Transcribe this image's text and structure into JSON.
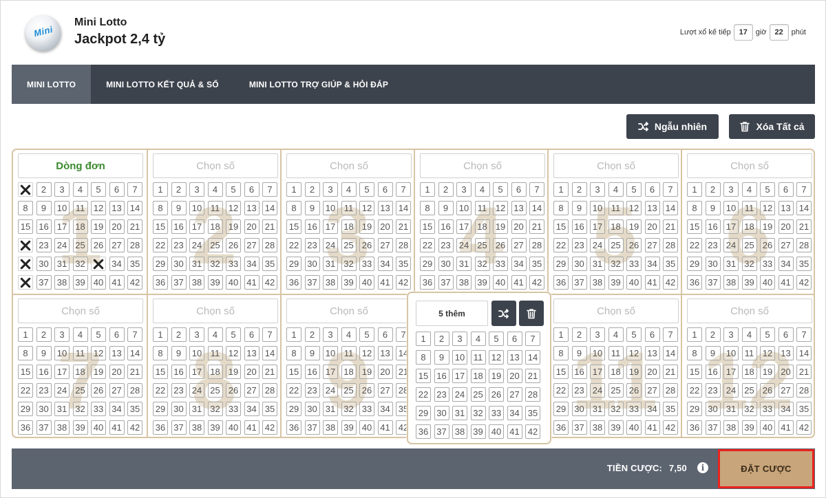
{
  "header": {
    "logo_text": "Mini",
    "game_name": "Mini Lotto",
    "jackpot": "Jackpot 2,4 tỷ",
    "next_draw_label": "Lượt xổ kế tiếp",
    "hours": "17",
    "hours_unit": "giờ",
    "minutes": "22",
    "minutes_unit": "phút"
  },
  "nav": {
    "items": [
      {
        "label": "MINI LOTTO",
        "active": true
      },
      {
        "label": "MINI LOTTO KẾT QUẢ & SỐ",
        "active": false
      },
      {
        "label": "MINI LOTTO TRỢ GIÚP & HỎI ĐÁP",
        "active": false
      }
    ]
  },
  "actions": {
    "random_label": "Ngẫu nhiên",
    "clear_all_label": "Xóa Tất cả"
  },
  "icons": {
    "random": "shuffle-icon",
    "clear": "trash-icon",
    "info": "info-icon"
  },
  "tickets": {
    "numbers": [
      1,
      2,
      3,
      4,
      5,
      6,
      7,
      8,
      9,
      10,
      11,
      12,
      13,
      14,
      15,
      16,
      17,
      18,
      19,
      20,
      21,
      22,
      23,
      24,
      25,
      26,
      27,
      28,
      29,
      30,
      31,
      32,
      33,
      34,
      35,
      36,
      37,
      38,
      39,
      40,
      41,
      42
    ],
    "panels": [
      {
        "index": "1",
        "label": "Dòng đơn",
        "selected": [
          1,
          22,
          29,
          33,
          36
        ]
      },
      {
        "index": "2",
        "label": "Chọn số",
        "selected": []
      },
      {
        "index": "3",
        "label": "Chọn số",
        "selected": []
      },
      {
        "index": "4",
        "label": "Chọn số",
        "selected": []
      },
      {
        "index": "5",
        "label": "Chọn số",
        "selected": []
      },
      {
        "index": "6",
        "label": "Chọn số",
        "selected": []
      },
      {
        "index": "7",
        "label": "Chọn số",
        "selected": []
      },
      {
        "index": "8",
        "label": "Chọn số",
        "selected": []
      },
      {
        "index": "9",
        "label": "Chọn số",
        "selected": []
      },
      {
        "index": "10",
        "label": "5 thêm",
        "selected": [],
        "expanded": true
      },
      {
        "index": "11",
        "label": "Chọn số",
        "selected": []
      },
      {
        "index": "12",
        "label": "Chọn số",
        "selected": []
      }
    ]
  },
  "footer": {
    "bet_label": "TIỀN CƯỢC:",
    "bet_value": "7,50",
    "place_bet_label": "ĐẶT CƯỢC"
  },
  "colors": {
    "nav_bg": "#3d434d",
    "nav_active": "#5c6470",
    "ticket_border": "#d7c4a4",
    "watermark": "#e0d4be",
    "place_bet_bg": "#c8a57a",
    "highlight_border": "#e8231f",
    "first_label": "#3b8a2e"
  }
}
